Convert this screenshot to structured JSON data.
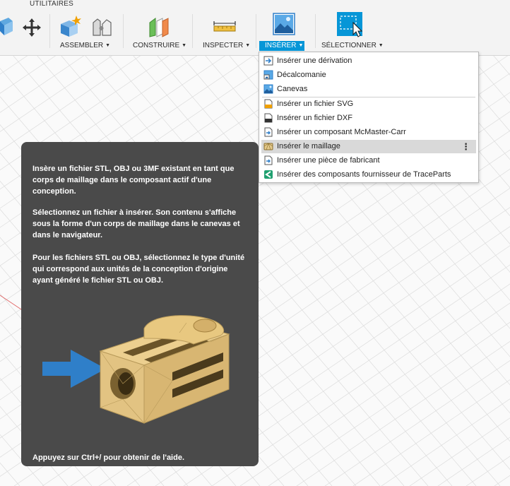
{
  "toolbar": {
    "utilities_label": "UTILITAIRES",
    "groups": [
      {
        "label": "ASSEMBLER"
      },
      {
        "label": "CONSTRUIRE"
      },
      {
        "label": "INSPECTER"
      },
      {
        "label": "INSÉRER",
        "active": true
      },
      {
        "label": "SÉLECTIONNER"
      }
    ],
    "caret": "▼"
  },
  "menu": {
    "items": [
      {
        "label": "Insérer une dérivation",
        "icon": "insert-derive-icon"
      },
      {
        "label": "Décalcomanie",
        "icon": "decal-icon"
      },
      {
        "label": "Canevas",
        "icon": "canvas-image-icon"
      },
      {
        "label": "Insérer un fichier SVG",
        "icon": "svg-file-icon"
      },
      {
        "label": "Insérer un fichier DXF",
        "icon": "dxf-file-icon"
      },
      {
        "label": "Insérer un composant McMaster-Carr",
        "icon": "mcmaster-icon"
      },
      {
        "label": "Insérer le maillage",
        "icon": "mesh-icon",
        "highlighted": true
      },
      {
        "label": "Insérer une pièce de fabricant",
        "icon": "manufacturer-part-icon"
      },
      {
        "label": "Insérer des composants fournisseur de TraceParts",
        "icon": "traceparts-icon"
      }
    ],
    "more_glyph": "⋮"
  },
  "tooltip": {
    "paragraphs": [
      "Insère un fichier STL, OBJ ou 3MF existant en tant que corps de maillage dans le composant actif d'une conception.",
      "Sélectionnez un fichier à insérer. Son contenu s'affiche sous la forme d'un corps de maillage dans le canevas et dans le navigateur.",
      "Pour les fichiers STL ou OBJ, sélectionnez le type d'unité qui correspond aux unités de la conception d'origine ayant généré le fichier STL ou OBJ."
    ],
    "footer": "Appuyez sur Ctrl+/ pour obtenir de l'aide."
  },
  "colors": {
    "accent": "#0696d7",
    "tooltip_bg": "#4a4a4a",
    "mesh_part": "#e3c98c",
    "arrow": "#2f7fc9"
  }
}
